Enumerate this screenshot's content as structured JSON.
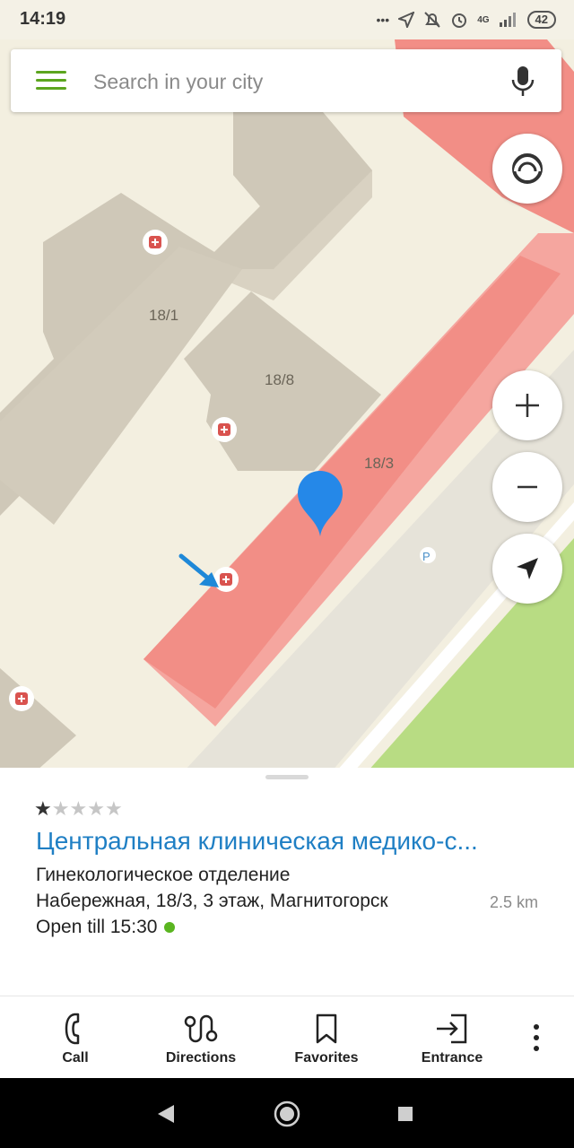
{
  "status_bar": {
    "time": "14:19",
    "network": "4G",
    "battery": "42"
  },
  "search": {
    "placeholder": "Search in your city"
  },
  "map": {
    "building_labels": [
      "18/1",
      "18/8",
      "18/3"
    ],
    "parking_label": "P"
  },
  "place": {
    "rating_stars": [
      true,
      false,
      false,
      false,
      false
    ],
    "title": "Центральная клиническая медико-с...",
    "subtitle": "Гинекологическое отделение",
    "address": "Набережная, 18/3, 3 этаж, Магнитогорск",
    "distance": "2.5 km",
    "hours": "Open till 15:30",
    "open_color": "#5ab520"
  },
  "actions": [
    {
      "label": "Call",
      "icon": "phone-icon"
    },
    {
      "label": "Directions",
      "icon": "route-icon"
    },
    {
      "label": "Favorites",
      "icon": "bookmark-icon"
    },
    {
      "label": "Entrance",
      "icon": "entrance-icon"
    }
  ],
  "colors": {
    "accent": "#1f7fc4",
    "menu": "#5ca51f",
    "highlight_building": "#f28e86"
  }
}
